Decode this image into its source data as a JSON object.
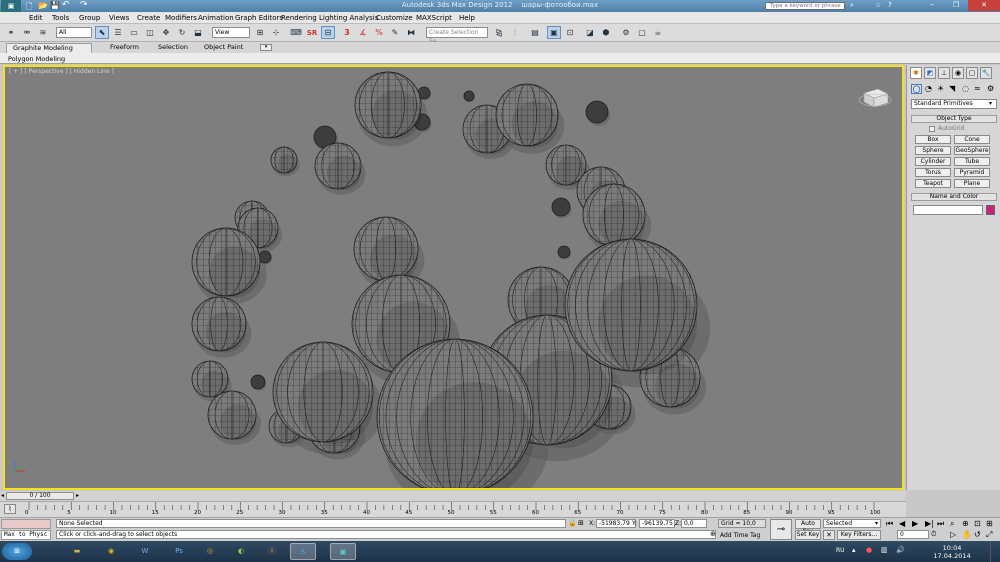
{
  "title": {
    "app": "Autodesk 3ds Max Design 2012",
    "file": "шары-фотообои.max",
    "search_placeholder": "Type a keyword or phrase"
  },
  "menu": [
    "Edit",
    "Tools",
    "Group",
    "Views",
    "Create",
    "Modifiers",
    "Animation",
    "Graph Editors",
    "Rendering",
    "Lighting Analysis",
    "Customize",
    "MAXScript",
    "Help"
  ],
  "toolbar": {
    "selection_filter": "All",
    "ref_coord": "View",
    "named_selection": "Create Selection Se",
    "snap_labels": [
      "SR",
      "SR",
      "3"
    ]
  },
  "ribbon": {
    "tabs": [
      "Graphite Modeling Tools",
      "Freeform",
      "Selection",
      "Object Paint"
    ],
    "panel": "Polygon Modeling"
  },
  "viewport": {
    "label": "[ + ] [ Perspective ] [ Hidden Line ]"
  },
  "command_panel": {
    "category": "Standard Primitives",
    "object_type_header": "Object Type",
    "autogrid": "AutoGrid",
    "buttons": [
      "Box",
      "Cone",
      "Sphere",
      "GeoSphere",
      "Cylinder",
      "Tube",
      "Torus",
      "Pyramid",
      "Teapot",
      "Plane"
    ],
    "name_color_header": "Name and Color",
    "name_value": "",
    "color": "#c8237a"
  },
  "time": {
    "slider": "0 / 100",
    "ticks": [
      "0",
      "5",
      "10",
      "15",
      "20",
      "25",
      "30",
      "35",
      "40",
      "45",
      "50",
      "55",
      "60",
      "65",
      "70",
      "75",
      "80",
      "85",
      "90",
      "95",
      "100"
    ]
  },
  "status": {
    "selection": "None Selected",
    "prompt": "Click or click-and-drag to select objects",
    "listener": "Max to Physc",
    "x_label": "X:",
    "x": "-51983,79",
    "y_label": "Y:",
    "y": "-96139,75",
    "z_label": "Z:",
    "z": "0,0",
    "grid": "Grid = 10,0",
    "add_time_tag": "Add Time Tag",
    "auto_key": "Auto Key",
    "set_key": "Set Key",
    "key_mode": "Selected",
    "key_filters": "Key Filters...",
    "frame": "0"
  },
  "taskbar": {
    "lang": "RU",
    "time": "10:04",
    "date": "17.04.2014"
  },
  "accent": "#f5e11b"
}
